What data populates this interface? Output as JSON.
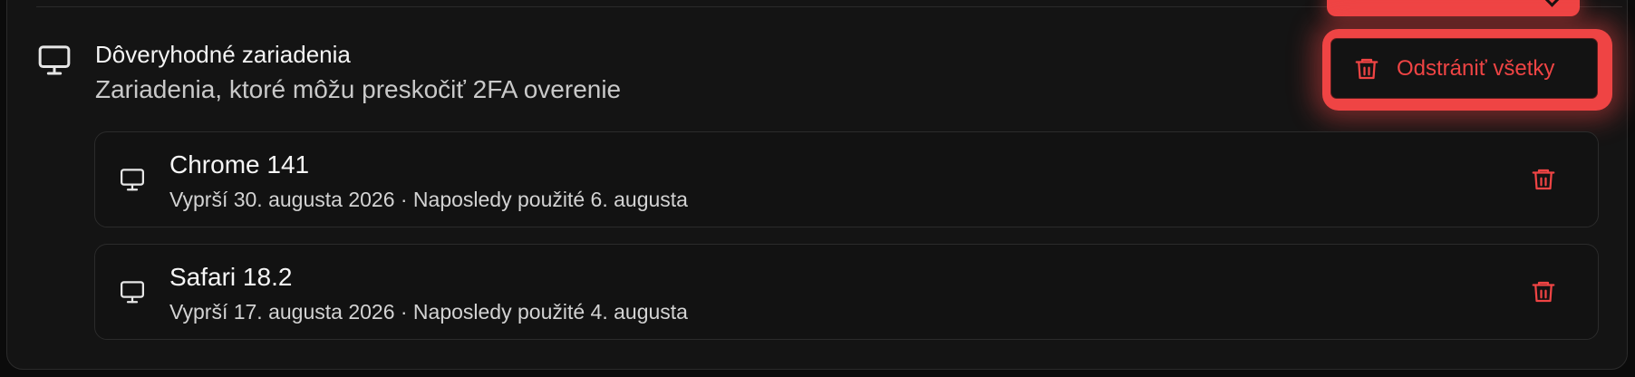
{
  "section": {
    "title": "Dôveryhodné zariadenia",
    "description": "Zariadenia, ktoré môžu preskočiť 2FA overenie",
    "icon": "monitor-icon"
  },
  "actions": {
    "remove_all_label": "Odstrániť všetky",
    "remove_all_icon": "trash-icon"
  },
  "devices": [
    {
      "name": "Chrome 141",
      "meta": "Vyprší 30. augusta 2026 · Naposledy použité 6. augusta",
      "icon": "monitor-icon",
      "delete_icon": "trash-icon"
    },
    {
      "name": "Safari 18.2",
      "meta": "Vyprší 17. augusta 2026 · Naposledy použité 4. augusta",
      "icon": "monitor-icon",
      "delete_icon": "trash-icon"
    }
  ],
  "colors": {
    "accent_red": "#ef4444",
    "background": "#141414",
    "border": "#2b2b2b"
  }
}
